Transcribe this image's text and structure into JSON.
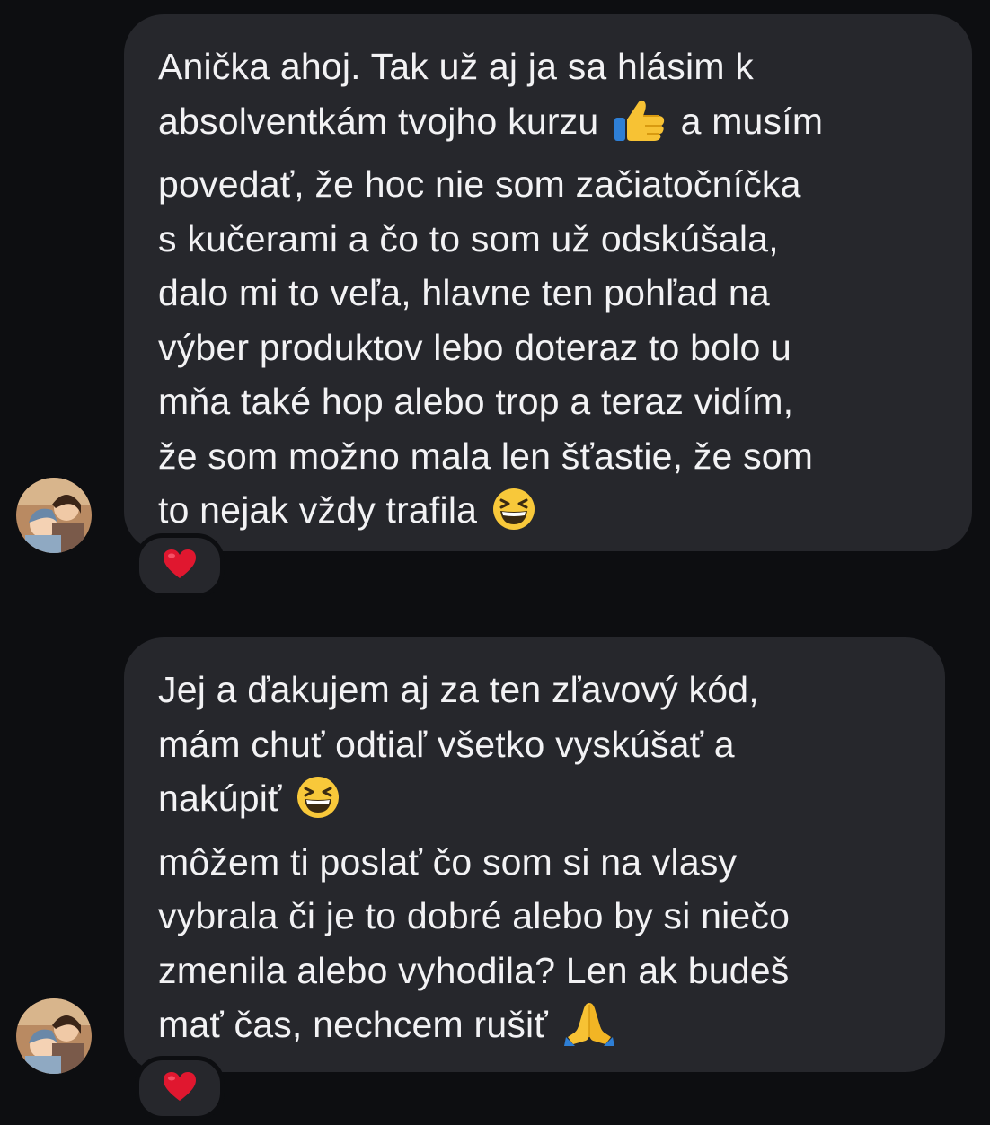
{
  "messages": [
    {
      "lines": [
        "Anička ahoj. Tak už aj ja sa hlásim k",
        "absolventkám tvojho kurzu",
        "a musím",
        "povedať, že hoc nie som začiatočníčka",
        "s kučerami a čo to som už odskúšala,",
        "dalo mi to veľa, hlavne ten pohľad na",
        "výber produktov lebo doteraz to bolo u",
        "mňa také hop alebo trop a teraz vidím,",
        "že som možno mala len šťastie, že som",
        "to nejak vždy trafila"
      ],
      "emojis": [
        "thumbs-up-emoji",
        "grinning-squinting-face-emoji"
      ],
      "reaction": "red-heart-emoji"
    },
    {
      "lines": [
        "Jej a ďakujem aj za ten zľavový kód,",
        "mám chuť odtiaľ všetko vyskúšať a",
        "nakúpiť",
        "môžem ti poslať čo som si na vlasy",
        "vybrala či je to dobré alebo by si niečo",
        "zmenila alebo vyhodila? Len ak budeš",
        "mať čas, nechcem rušiť"
      ],
      "emojis": [
        "grinning-squinting-face-emoji",
        "folded-hands-emoji"
      ],
      "reaction": "red-heart-emoji"
    }
  ],
  "colors": {
    "background": "#0d0e11",
    "bubble": "#26272c",
    "text": "#f2f2f4",
    "heart": "#e0172f"
  }
}
